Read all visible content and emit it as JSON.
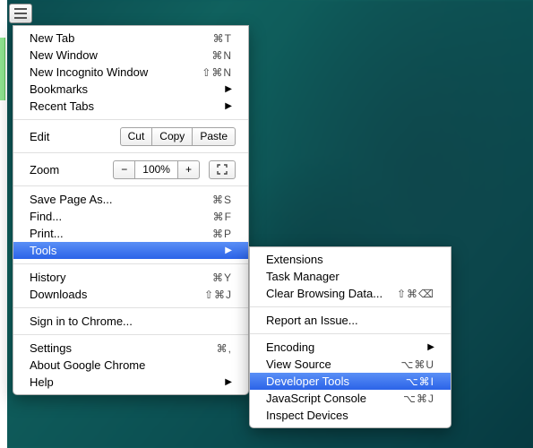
{
  "menu_button": {
    "name": "chrome-menu"
  },
  "main_menu": {
    "new_tab": {
      "label": "New Tab",
      "shortcut": "⌘T"
    },
    "new_window": {
      "label": "New Window",
      "shortcut": "⌘N"
    },
    "new_incognito": {
      "label": "New Incognito Window",
      "shortcut": "⇧⌘N"
    },
    "bookmarks": {
      "label": "Bookmarks"
    },
    "recent_tabs": {
      "label": "Recent Tabs"
    },
    "edit": {
      "label": "Edit",
      "cut": "Cut",
      "copy": "Copy",
      "paste": "Paste"
    },
    "zoom": {
      "label": "Zoom",
      "minus": "−",
      "pct": "100%",
      "plus": "+"
    },
    "save_page": {
      "label": "Save Page As...",
      "shortcut": "⌘S"
    },
    "find": {
      "label": "Find...",
      "shortcut": "⌘F"
    },
    "print": {
      "label": "Print...",
      "shortcut": "⌘P"
    },
    "tools": {
      "label": "Tools"
    },
    "history": {
      "label": "History",
      "shortcut": "⌘Y"
    },
    "downloads": {
      "label": "Downloads",
      "shortcut": "⇧⌘J"
    },
    "sign_in": {
      "label": "Sign in to Chrome..."
    },
    "settings": {
      "label": "Settings",
      "shortcut": "⌘,"
    },
    "about": {
      "label": "About Google Chrome"
    },
    "help": {
      "label": "Help"
    }
  },
  "tools_submenu": {
    "extensions": {
      "label": "Extensions"
    },
    "task_manager": {
      "label": "Task Manager"
    },
    "clear_browsing": {
      "label": "Clear Browsing Data...",
      "shortcut": "⇧⌘⌫"
    },
    "report_issue": {
      "label": "Report an Issue..."
    },
    "encoding": {
      "label": "Encoding"
    },
    "view_source": {
      "label": "View Source",
      "shortcut": "⌥⌘U"
    },
    "developer_tools": {
      "label": "Developer Tools",
      "shortcut": "⌥⌘I"
    },
    "js_console": {
      "label": "JavaScript Console",
      "shortcut": "⌥⌘J"
    },
    "inspect_devices": {
      "label": "Inspect Devices"
    }
  }
}
